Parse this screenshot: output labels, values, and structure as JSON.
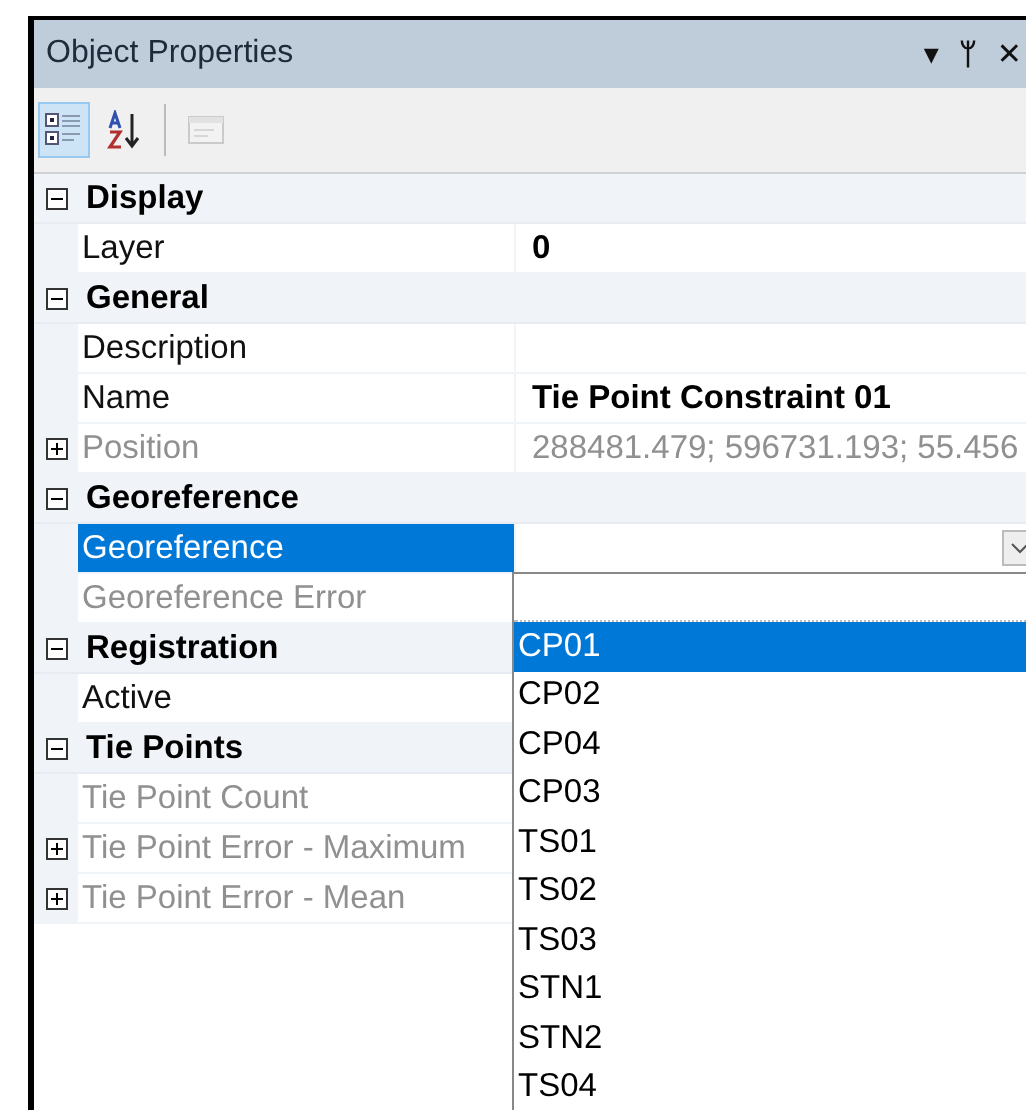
{
  "window": {
    "title": "Object Properties"
  },
  "title_buttons": [
    "▾",
    "ᛘ",
    "✕"
  ],
  "toolbar": [
    {
      "kind": "categorized",
      "selected": true,
      "disabled": false
    },
    {
      "kind": "alphabetical",
      "selected": false,
      "disabled": false
    },
    {
      "kind": "pages",
      "selected": false,
      "disabled": true
    }
  ],
  "categories": [
    {
      "name": "Display",
      "expanded": true,
      "properties": [
        {
          "label": "Layer",
          "value": "0",
          "bold": true,
          "disabled": false,
          "expandable": false,
          "selected": false
        }
      ]
    },
    {
      "name": "General",
      "expanded": true,
      "properties": [
        {
          "label": "Description",
          "disabled": false,
          "expandable": false,
          "selected": false
        },
        {
          "label": "Name",
          "value": "Tie Point Constraint 01",
          "bold": true,
          "disabled": false,
          "expandable": false,
          "selected": false
        },
        {
          "label": "Position",
          "value": "288481.479; 596731.193; 55.456",
          "bold": false,
          "disabled": true,
          "expandable": true,
          "expanded": false,
          "selected": false
        }
      ]
    },
    {
      "name": "Georeference",
      "expanded": true,
      "properties": [
        {
          "label": "Georeference",
          "disabled": false,
          "expandable": false,
          "selected": true,
          "kind": "dropdown"
        },
        {
          "label": "Georeference Error",
          "disabled": true,
          "expandable": false,
          "selected": false
        }
      ]
    },
    {
      "name": "Registration",
      "expanded": true,
      "properties": [
        {
          "label": "Active",
          "disabled": false,
          "expandable": false,
          "selected": false
        }
      ]
    },
    {
      "name": "Tie Points",
      "expanded": true,
      "properties": [
        {
          "label": "Tie Point Count",
          "disabled": true,
          "expandable": false,
          "selected": false
        },
        {
          "label": "Tie Point Error - Maximum",
          "disabled": true,
          "expandable": true,
          "expanded": false,
          "selected": false
        },
        {
          "label": "Tie Point Error - Mean",
          "disabled": true,
          "expandable": true,
          "expanded": false,
          "selected": false
        }
      ]
    }
  ],
  "dropdown_list": [
    {
      "label": "CP01",
      "selected": true
    },
    {
      "label": "CP02",
      "selected": false
    },
    {
      "label": "CP04",
      "selected": false
    },
    {
      "label": "CP03",
      "selected": false
    },
    {
      "label": "TS01",
      "selected": false
    },
    {
      "label": "TS02",
      "selected": false
    },
    {
      "label": "TS03",
      "selected": false
    },
    {
      "label": "STN1",
      "selected": false
    },
    {
      "label": "STN2",
      "selected": false
    },
    {
      "label": "TS04",
      "selected": false
    }
  ]
}
